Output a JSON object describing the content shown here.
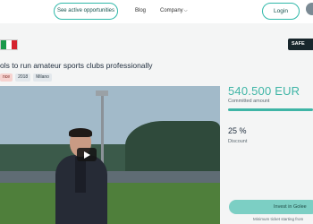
{
  "nav": {
    "active_opportunities_label": "See active opportunities",
    "blog_label": "Blog",
    "company_label": "Company",
    "login_label": "Login"
  },
  "badge": {
    "safe_label": "SAFE"
  },
  "company": {
    "tagline": "ols to run amateur sports clubs professionally",
    "tags": [
      {
        "label": "nce",
        "highlight": true
      },
      {
        "label": "2018",
        "highlight": false
      },
      {
        "label": "Milano",
        "highlight": false
      }
    ]
  },
  "campaign": {
    "amount": "540.500 EUR",
    "committed_label": "Committed amount",
    "committed_progress_percent": 100,
    "discount_value": "25 %",
    "discount_label": "Discount",
    "invest_label": "Invest in Golee",
    "min_ticket_label": "Minimum ticket starting from"
  },
  "colors": {
    "accent": "#3fb5a6",
    "pill_border": "#2fb8a9",
    "badge_bg": "#18262c",
    "invest_bg": "#7ccfc4"
  },
  "icons": {
    "company_dropdown": "chevron-down-icon",
    "video_play": "play-icon"
  }
}
